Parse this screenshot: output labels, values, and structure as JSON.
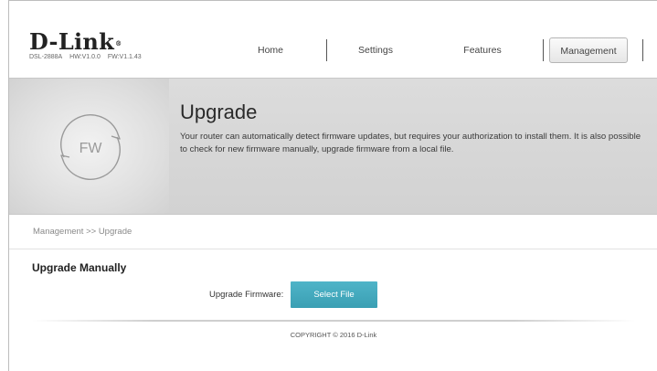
{
  "header": {
    "logo_text": "D-Link",
    "logo_reg": "®",
    "model": "DSL-2888A",
    "hw_version": "HW:V1.0.0",
    "fw_version": "FW:V1.1.43"
  },
  "nav": {
    "items": [
      {
        "label": "Home"
      },
      {
        "label": "Settings"
      },
      {
        "label": "Features"
      },
      {
        "label": "Management"
      }
    ],
    "active": "Management"
  },
  "banner": {
    "icon_text": "FW",
    "title": "Upgrade",
    "description": "Your router can automatically detect firmware updates, but requires your authorization to install them. It is also possible to check for new firmware manually, upgrade firmware from a local file."
  },
  "breadcrumb": "Management >> Upgrade",
  "section": {
    "title": "Upgrade Manually",
    "firmware_label": "Upgrade Firmware:",
    "select_button": "Select File"
  },
  "footer": {
    "copyright": "COPYRIGHT © 2016 D-Link"
  },
  "colors": {
    "accent": "#44a9bd",
    "banner_bg": "#d6d6d6"
  }
}
